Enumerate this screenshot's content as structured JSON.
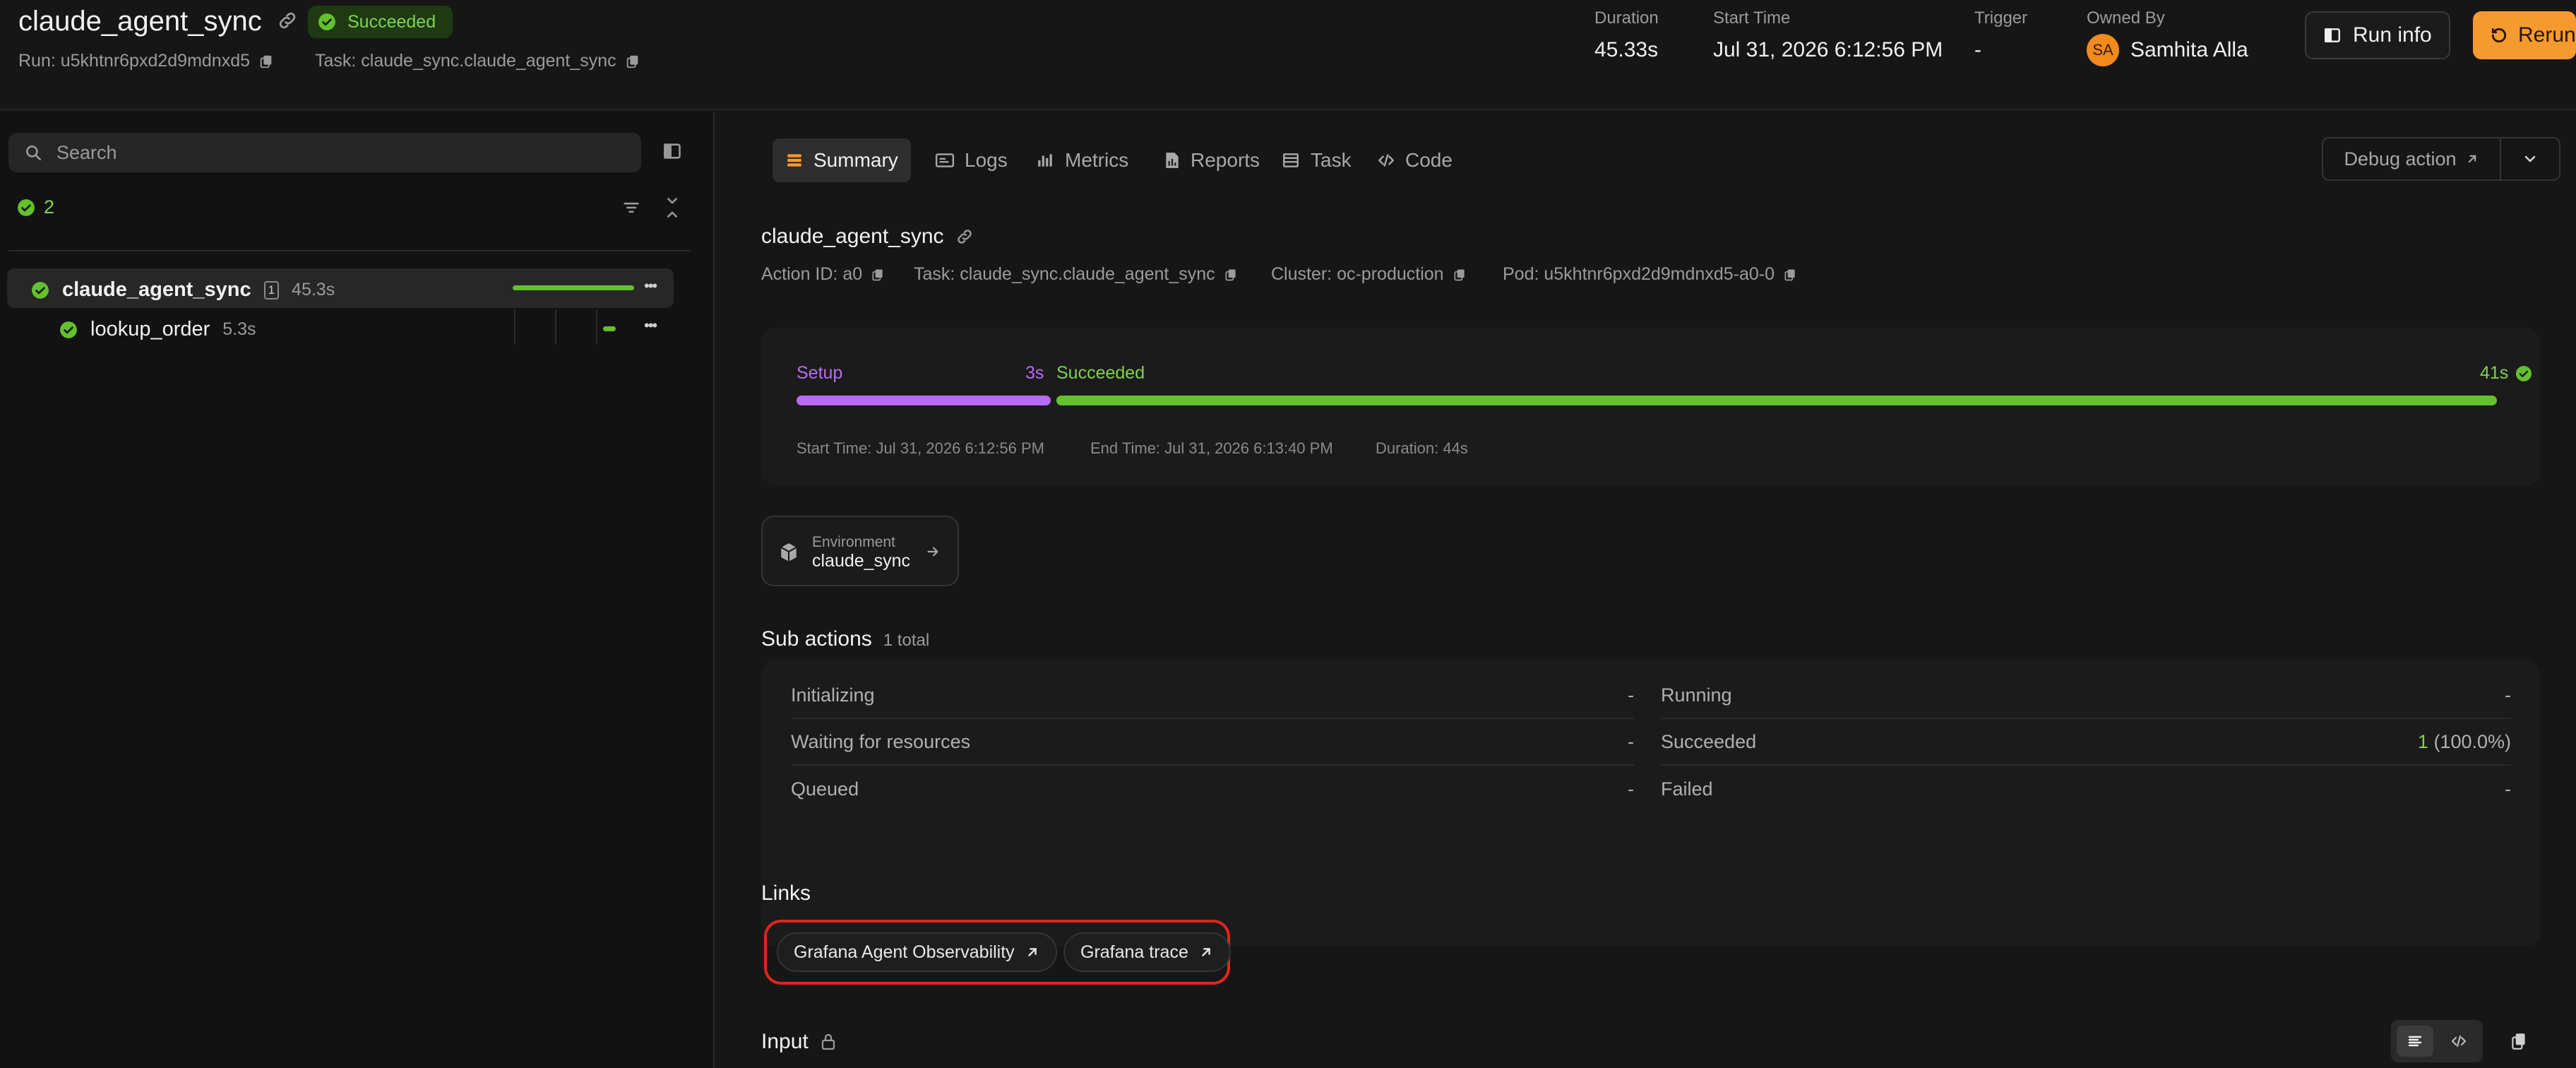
{
  "header": {
    "run_name": "claude_agent_sync",
    "status": "Succeeded",
    "run_id": "Run: u5khtnr6pxd2d9mdnxd5",
    "task": "Task: claude_sync.claude_agent_sync",
    "duration_label": "Duration",
    "duration_value": "45.33s",
    "start_label": "Start Time",
    "start_value": "Jul 31, 2026 6:12:56 PM",
    "trigger_label": "Trigger",
    "trigger_value": "-",
    "owner_label": "Owned By",
    "owner_initials": "SA",
    "owner_name": "Samhita Alla",
    "run_info_label": "Run info",
    "rerun_label": "Rerun"
  },
  "sidebar": {
    "search_placeholder": "Search",
    "succeeded_count": "2",
    "tree": [
      {
        "name": "claude_agent_sync",
        "badge": "1",
        "duration": "45.3s",
        "progress": 1.0
      },
      {
        "name": "lookup_order",
        "duration": "5.3s"
      }
    ],
    "more_glyph": "•••"
  },
  "tabs": [
    {
      "label": "Summary",
      "icon": "summary-icon"
    },
    {
      "label": "Logs",
      "icon": "logs-icon"
    },
    {
      "label": "Metrics",
      "icon": "metrics-icon"
    },
    {
      "label": "Reports",
      "icon": "reports-icon"
    },
    {
      "label": "Task",
      "icon": "task-icon"
    },
    {
      "label": "Code",
      "icon": "code-icon"
    }
  ],
  "debug_action_label": "Debug action",
  "action": {
    "name": "claude_agent_sync",
    "action_id": "Action ID: a0",
    "task": "Task: claude_sync.claude_agent_sync",
    "cluster": "Cluster: oc-production",
    "pod": "Pod: u5khtnr6pxd2d9mdnxd5-a0-0"
  },
  "timeline": {
    "setup_label": "Setup",
    "setup_duration": "3s",
    "succeeded_label": "Succeeded",
    "succeeded_duration": "41s",
    "start_time": "Start Time: Jul 31, 2026 6:12:56 PM",
    "end_time": "End Time: Jul 31, 2026 6:13:40 PM",
    "total_duration": "Duration: 44s",
    "setup_color": "#b56cf2",
    "succeeded_color": "#64c02e"
  },
  "environment": {
    "label": "Environment",
    "value": "claude_sync"
  },
  "sub_actions": {
    "title": "Sub actions",
    "total": "1 total",
    "left": [
      {
        "label": "Initializing",
        "value": "-"
      },
      {
        "label": "Waiting for resources",
        "value": "-"
      },
      {
        "label": "Queued",
        "value": "-"
      }
    ],
    "right": [
      {
        "label": "Running",
        "value": "-",
        "extra": ""
      },
      {
        "label": "Succeeded",
        "value": "1",
        "extra": " (100.0%)"
      },
      {
        "label": "Failed",
        "value": "-",
        "extra": ""
      }
    ]
  },
  "links": {
    "title": "Links",
    "items": [
      {
        "label": "Grafana Agent Observability"
      },
      {
        "label": "Grafana trace"
      }
    ]
  },
  "input": {
    "title": "Input"
  },
  "colors": {
    "accent_orange": "#f59a2f",
    "success_green": "#64c02e",
    "highlight_red": "#e0241e"
  }
}
